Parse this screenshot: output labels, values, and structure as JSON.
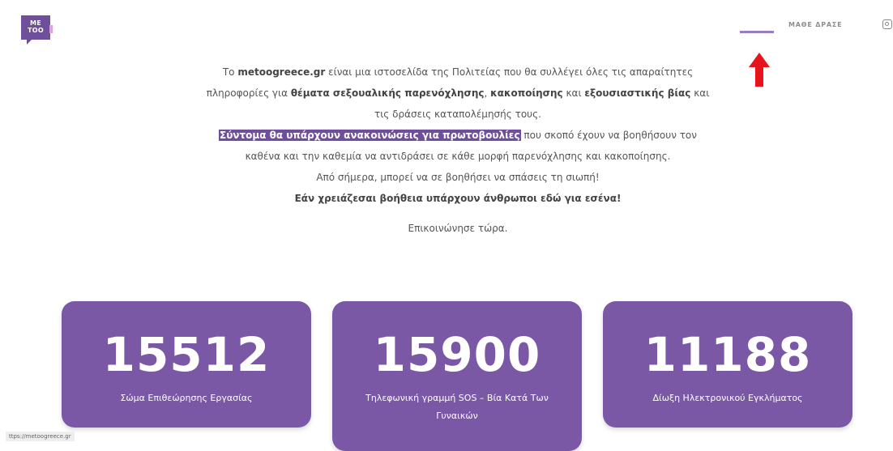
{
  "logo": {
    "line1": "ME",
    "line2": "TOO"
  },
  "nav": {
    "link": "ΜΑΘΕ ΔΡΑΣΕ"
  },
  "intro": {
    "l1a": "Το ",
    "l1b": "metoogreece.gr",
    "l1c": " είναι μια ιστοσελίδα της Πολιτείας που θα συλλέγει όλες τις απαραίτητες",
    "l2a": "πληροφορίες για ",
    "l2b": "θέματα σεξουαλικής παρενόχλησης",
    "l2c": ", ",
    "l2d": "κακοποίησης",
    "l2e": " και ",
    "l2f": "εξουσιαστικής βίας",
    "l2g": " και",
    "l3": "τις δράσεις καταπολέμησής τους.",
    "l4a": "Σύντομα θα υπάρχουν ανακοινώσεις για πρωτοβουλίες",
    "l4b": " που σκοπό έχουν να βοηθήσουν τον",
    "l5": "καθένα και την καθεμία να αντιδράσει σε κάθε μορφή παρενόχλησης και κακοποίησης.",
    "l6": "Από σήμερα, μπορεί να σε βοηθήσει να σπάσεις τη σιωπή!",
    "l7": "Εάν χρειάζεσαι βοήθεια υπάρχουν άνθρωποι εδώ για εσένα!"
  },
  "contact": "Επικοινώνησε τώρα.",
  "cards": [
    {
      "number": "15512",
      "label": "Σώμα Επιθεώρησης Εργασίας"
    },
    {
      "number": "15900",
      "label": "Τηλεφωνική γραμμή SOS – Βία Κατά Των Γυναικών"
    },
    {
      "number": "11188",
      "label": "Δίωξη Ηλεκτρονικού Εγκλήματος"
    }
  ],
  "status_url": "ttps://metoogreece.gr",
  "colors": {
    "brand": "#7a58a6",
    "arrow": "#e8141b"
  }
}
